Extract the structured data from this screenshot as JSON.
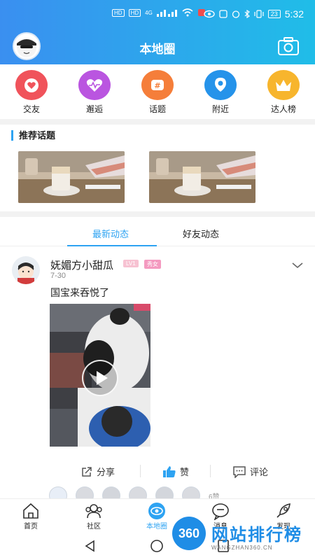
{
  "status_bar": {
    "left_chips": [
      "HD",
      "HD"
    ],
    "signal": "4G",
    "battery": "23",
    "time": "5:32"
  },
  "header": {
    "title": "本地圈"
  },
  "categories": [
    {
      "label": "交友",
      "color": "#f0535b",
      "icon": "heart-chat-icon"
    },
    {
      "label": "邂逅",
      "color": "#ba55e0",
      "icon": "heartbeat-icon"
    },
    {
      "label": "话题",
      "color": "#f57e3a",
      "icon": "hashtag-icon"
    },
    {
      "label": "附近",
      "color": "#2593ea",
      "icon": "location-icon"
    },
    {
      "label": "达人榜",
      "color": "#f7b52d",
      "icon": "crown-icon"
    }
  ],
  "recommend": {
    "title": "推荐话题"
  },
  "tabs": [
    {
      "label": "最新动态",
      "active": true
    },
    {
      "label": "好友动态",
      "active": false
    }
  ],
  "post": {
    "username": "妩媚方小甜瓜",
    "level_badge": "LV1",
    "tag_badge": "秀女",
    "date": "7-30",
    "text": "国宝来吞悦了",
    "actions": {
      "share": "分享",
      "like": "赞",
      "comment": "评论"
    },
    "likers_count": "6赞"
  },
  "bottom_nav": [
    {
      "label": "首页",
      "icon": "home-icon",
      "active": false
    },
    {
      "label": "社区",
      "icon": "community-icon",
      "active": false
    },
    {
      "label": "本地圈",
      "icon": "eye-icon",
      "active": true
    },
    {
      "label": "消息",
      "icon": "message-icon",
      "active": false
    },
    {
      "label": "发现",
      "icon": "rocket-icon",
      "active": false
    }
  ],
  "watermark": {
    "badge": "360",
    "text": "网站排行榜",
    "sub": "WANGZHAN360.CN"
  },
  "colors": {
    "accent": "#2ea3f2",
    "header_start": "#3a8ff0",
    "header_end": "#20bde8"
  }
}
